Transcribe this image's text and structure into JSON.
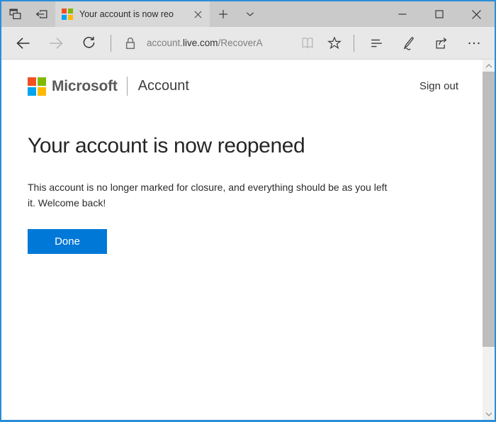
{
  "colors": {
    "accent": "#0078d7",
    "window_border": "#2a8ed8",
    "ms_red": "#f25022",
    "ms_green": "#7fba00",
    "ms_blue": "#00a4ef",
    "ms_yellow": "#ffb900"
  },
  "browser": {
    "tab_bar": {
      "active_tab": {
        "title": "Your account is now reo"
      }
    },
    "toolbar": {
      "url": {
        "subdomain": "account.",
        "domain": "live.com",
        "path": "/RecoverA"
      }
    }
  },
  "page": {
    "header": {
      "brand": "Microsoft",
      "product": "Account",
      "sign_out_label": "Sign out"
    },
    "main": {
      "heading": "Your account is now reopened",
      "body_line1": "This account is no longer marked for closure, and everything should be as you left",
      "body_line2": "it. Welcome back!",
      "done_button_label": "Done"
    }
  }
}
